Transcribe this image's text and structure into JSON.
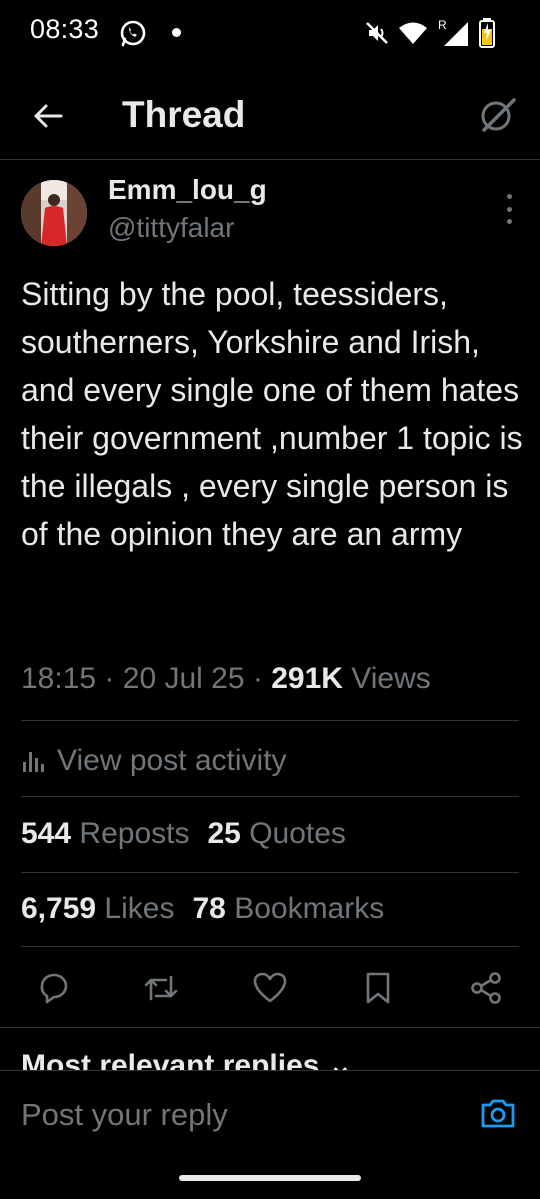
{
  "status_bar": {
    "time": "08:33",
    "icons": [
      "whatsapp-icon",
      "notification-dot",
      "mute-icon",
      "wifi-icon",
      "roaming-signal-icon",
      "battery-charging-icon"
    ],
    "roaming_label": "R"
  },
  "header": {
    "title": "Thread",
    "back_icon": "arrow-left-icon",
    "grok_icon": "grok-icon"
  },
  "post": {
    "display_name": "Emm_lou_g",
    "handle": "@tittyfalar",
    "text": "Sitting by the pool, teessiders, southerners, Yorkshire and Irish, and every single one of them hates their government ,number 1 topic is the illegals , every single person is of the opinion they are an army",
    "time": "18:15",
    "date": "20 Jul 25",
    "separator": "·",
    "views_count": "291K",
    "views_label": "Views"
  },
  "activity": {
    "label": "View post activity",
    "icon": "bar-chart-icon"
  },
  "stats": {
    "reposts_count": "544",
    "reposts_label": "Reposts",
    "quotes_count": "25",
    "quotes_label": "Quotes",
    "likes_count": "6,759",
    "likes_label": "Likes",
    "bookmarks_count": "78",
    "bookmarks_label": "Bookmarks"
  },
  "actions": [
    "reply-icon",
    "repost-icon",
    "like-icon",
    "bookmark-icon",
    "share-icon"
  ],
  "replies_header": "Most relevant replies",
  "reply_bar": {
    "placeholder": "Post your reply",
    "camera_icon": "camera-icon"
  },
  "colors": {
    "background": "#000000",
    "primary_text": "#e7e9ea",
    "secondary_text": "#71767b",
    "divider": "#2f3336",
    "accent": "#1d9bf0",
    "battery": "#f5c518"
  }
}
